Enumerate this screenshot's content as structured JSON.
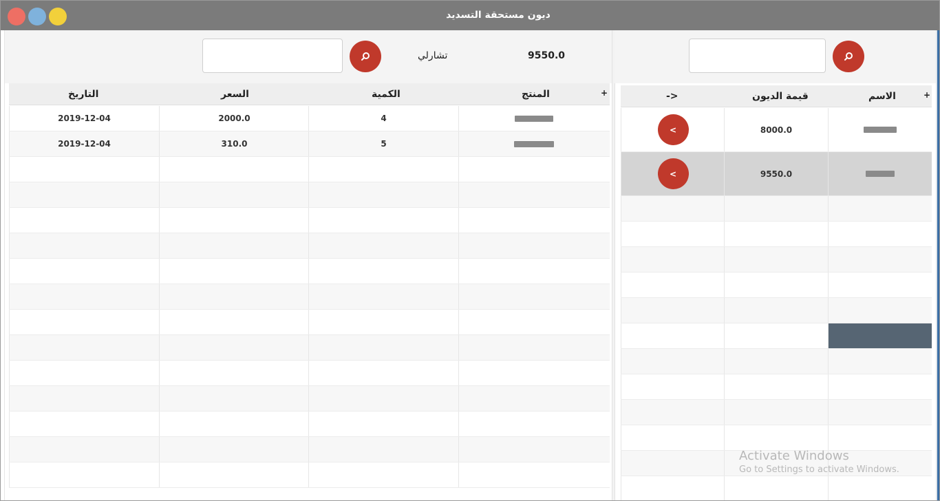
{
  "window": {
    "title": "ديون مستحقة التسديد",
    "controls": [
      "close",
      "minimize",
      "maximize"
    ]
  },
  "left_panel": {
    "summary_value": "9550.0",
    "customer_name": "تشارلي",
    "search_placeholder": "",
    "columns": [
      "المنتج",
      "الكمية",
      "السعر",
      "التاريخ"
    ],
    "add_column_symbol": "+",
    "rows": [
      {
        "product": "",
        "quantity": "4",
        "price": "2000.0",
        "date": "2019-12-04"
      },
      {
        "product": "",
        "quantity": "5",
        "price": "310.0",
        "date": "2019-12-04"
      }
    ]
  },
  "right_panel": {
    "search_placeholder": "",
    "columns": [
      "الاسم",
      "قيمة الديون",
      "->"
    ],
    "add_column_symbol": "+",
    "rows": [
      {
        "name": "",
        "debt": "8000.0",
        "action": "<"
      },
      {
        "name": "",
        "debt": "9550.0",
        "action": "<"
      }
    ]
  },
  "watermark": {
    "line1": "Activate Windows",
    "line2": "Go to Settings to activate Windows."
  },
  "colors": {
    "titlebar": "#7b7b7b",
    "accent_button": "#c0392b",
    "selected_row": "#d4d4d4",
    "highlight_cell": "#566573"
  }
}
